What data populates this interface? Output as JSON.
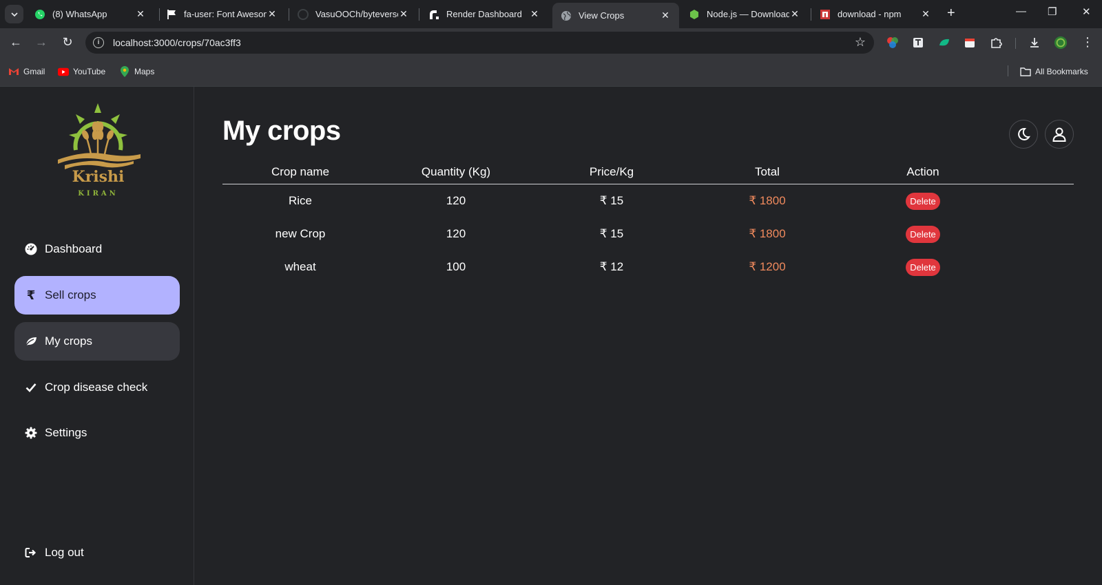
{
  "browser": {
    "tabs": [
      {
        "title": "(8) WhatsApp"
      },
      {
        "title": "fa-user: Font Awesome"
      },
      {
        "title": "VasuOOCh/byteverse"
      },
      {
        "title": "Render Dashboard"
      },
      {
        "title": "View Crops"
      },
      {
        "title": "Node.js — Download"
      },
      {
        "title": "download - npm"
      }
    ],
    "url": "localhost:3000/crops/70ac3ff3",
    "bookmarks": [
      {
        "label": "Gmail"
      },
      {
        "label": "YouTube"
      },
      {
        "label": "Maps"
      }
    ],
    "all_bookmarks": "All Bookmarks"
  },
  "sidebar": {
    "logo_title": "Krishi",
    "logo_subtitle": "KIRAN",
    "items": [
      {
        "label": "Dashboard",
        "icon": "dashboard-gauge-icon"
      },
      {
        "label": "Sell crops",
        "icon": "rupee-icon"
      },
      {
        "label": "My crops",
        "icon": "leaf-icon"
      },
      {
        "label": "Crop disease check",
        "icon": "check-icon"
      },
      {
        "label": "Settings",
        "icon": "gear-icon"
      }
    ],
    "logout": "Log out"
  },
  "main": {
    "title": "My crops",
    "table": {
      "headers": [
        "Crop name",
        "Quantity (Kg)",
        "Price/Kg",
        "Total",
        "Action"
      ],
      "rows": [
        {
          "name": "Rice",
          "qty": "120",
          "price": "₹ 15",
          "total": "₹ 1800",
          "action": "Delete"
        },
        {
          "name": "new Crop",
          "qty": "120",
          "price": "₹ 15",
          "total": "₹ 1800",
          "action": "Delete"
        },
        {
          "name": "wheat",
          "qty": "100",
          "price": "₹ 12",
          "total": "₹ 1200",
          "action": "Delete"
        }
      ]
    }
  },
  "colors": {
    "accent": "#b2b2ff",
    "total": "#f08a5d",
    "delete": "#e0363d"
  }
}
